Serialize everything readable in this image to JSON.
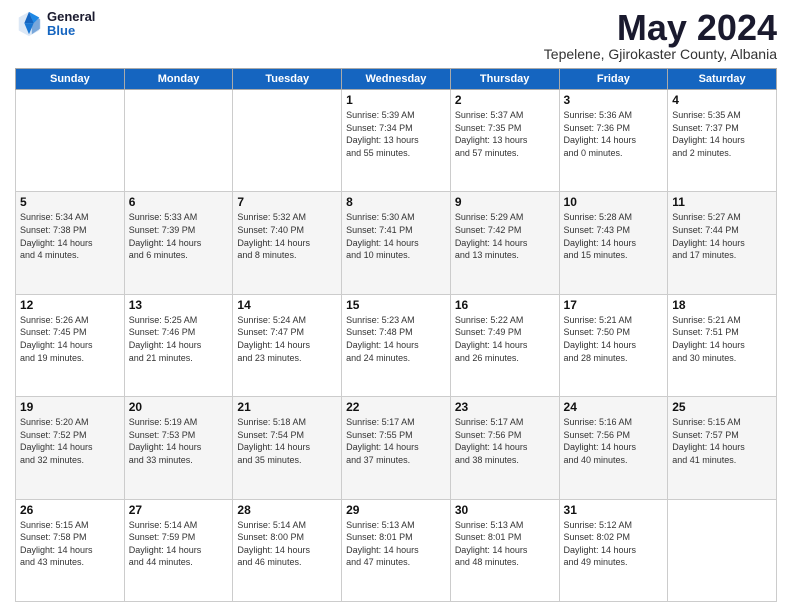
{
  "header": {
    "logo_general": "General",
    "logo_blue": "Blue",
    "month_title": "May 2024",
    "location": "Tepelene, Gjirokaster County, Albania"
  },
  "weekdays": [
    "Sunday",
    "Monday",
    "Tuesday",
    "Wednesday",
    "Thursday",
    "Friday",
    "Saturday"
  ],
  "weeks": [
    [
      {
        "day": "",
        "info": ""
      },
      {
        "day": "",
        "info": ""
      },
      {
        "day": "",
        "info": ""
      },
      {
        "day": "1",
        "info": "Sunrise: 5:39 AM\nSunset: 7:34 PM\nDaylight: 13 hours\nand 55 minutes."
      },
      {
        "day": "2",
        "info": "Sunrise: 5:37 AM\nSunset: 7:35 PM\nDaylight: 13 hours\nand 57 minutes."
      },
      {
        "day": "3",
        "info": "Sunrise: 5:36 AM\nSunset: 7:36 PM\nDaylight: 14 hours\nand 0 minutes."
      },
      {
        "day": "4",
        "info": "Sunrise: 5:35 AM\nSunset: 7:37 PM\nDaylight: 14 hours\nand 2 minutes."
      }
    ],
    [
      {
        "day": "5",
        "info": "Sunrise: 5:34 AM\nSunset: 7:38 PM\nDaylight: 14 hours\nand 4 minutes."
      },
      {
        "day": "6",
        "info": "Sunrise: 5:33 AM\nSunset: 7:39 PM\nDaylight: 14 hours\nand 6 minutes."
      },
      {
        "day": "7",
        "info": "Sunrise: 5:32 AM\nSunset: 7:40 PM\nDaylight: 14 hours\nand 8 minutes."
      },
      {
        "day": "8",
        "info": "Sunrise: 5:30 AM\nSunset: 7:41 PM\nDaylight: 14 hours\nand 10 minutes."
      },
      {
        "day": "9",
        "info": "Sunrise: 5:29 AM\nSunset: 7:42 PM\nDaylight: 14 hours\nand 13 minutes."
      },
      {
        "day": "10",
        "info": "Sunrise: 5:28 AM\nSunset: 7:43 PM\nDaylight: 14 hours\nand 15 minutes."
      },
      {
        "day": "11",
        "info": "Sunrise: 5:27 AM\nSunset: 7:44 PM\nDaylight: 14 hours\nand 17 minutes."
      }
    ],
    [
      {
        "day": "12",
        "info": "Sunrise: 5:26 AM\nSunset: 7:45 PM\nDaylight: 14 hours\nand 19 minutes."
      },
      {
        "day": "13",
        "info": "Sunrise: 5:25 AM\nSunset: 7:46 PM\nDaylight: 14 hours\nand 21 minutes."
      },
      {
        "day": "14",
        "info": "Sunrise: 5:24 AM\nSunset: 7:47 PM\nDaylight: 14 hours\nand 23 minutes."
      },
      {
        "day": "15",
        "info": "Sunrise: 5:23 AM\nSunset: 7:48 PM\nDaylight: 14 hours\nand 24 minutes."
      },
      {
        "day": "16",
        "info": "Sunrise: 5:22 AM\nSunset: 7:49 PM\nDaylight: 14 hours\nand 26 minutes."
      },
      {
        "day": "17",
        "info": "Sunrise: 5:21 AM\nSunset: 7:50 PM\nDaylight: 14 hours\nand 28 minutes."
      },
      {
        "day": "18",
        "info": "Sunrise: 5:21 AM\nSunset: 7:51 PM\nDaylight: 14 hours\nand 30 minutes."
      }
    ],
    [
      {
        "day": "19",
        "info": "Sunrise: 5:20 AM\nSunset: 7:52 PM\nDaylight: 14 hours\nand 32 minutes."
      },
      {
        "day": "20",
        "info": "Sunrise: 5:19 AM\nSunset: 7:53 PM\nDaylight: 14 hours\nand 33 minutes."
      },
      {
        "day": "21",
        "info": "Sunrise: 5:18 AM\nSunset: 7:54 PM\nDaylight: 14 hours\nand 35 minutes."
      },
      {
        "day": "22",
        "info": "Sunrise: 5:17 AM\nSunset: 7:55 PM\nDaylight: 14 hours\nand 37 minutes."
      },
      {
        "day": "23",
        "info": "Sunrise: 5:17 AM\nSunset: 7:56 PM\nDaylight: 14 hours\nand 38 minutes."
      },
      {
        "day": "24",
        "info": "Sunrise: 5:16 AM\nSunset: 7:56 PM\nDaylight: 14 hours\nand 40 minutes."
      },
      {
        "day": "25",
        "info": "Sunrise: 5:15 AM\nSunset: 7:57 PM\nDaylight: 14 hours\nand 41 minutes."
      }
    ],
    [
      {
        "day": "26",
        "info": "Sunrise: 5:15 AM\nSunset: 7:58 PM\nDaylight: 14 hours\nand 43 minutes."
      },
      {
        "day": "27",
        "info": "Sunrise: 5:14 AM\nSunset: 7:59 PM\nDaylight: 14 hours\nand 44 minutes."
      },
      {
        "day": "28",
        "info": "Sunrise: 5:14 AM\nSunset: 8:00 PM\nDaylight: 14 hours\nand 46 minutes."
      },
      {
        "day": "29",
        "info": "Sunrise: 5:13 AM\nSunset: 8:01 PM\nDaylight: 14 hours\nand 47 minutes."
      },
      {
        "day": "30",
        "info": "Sunrise: 5:13 AM\nSunset: 8:01 PM\nDaylight: 14 hours\nand 48 minutes."
      },
      {
        "day": "31",
        "info": "Sunrise: 5:12 AM\nSunset: 8:02 PM\nDaylight: 14 hours\nand 49 minutes."
      },
      {
        "day": "",
        "info": ""
      }
    ]
  ]
}
